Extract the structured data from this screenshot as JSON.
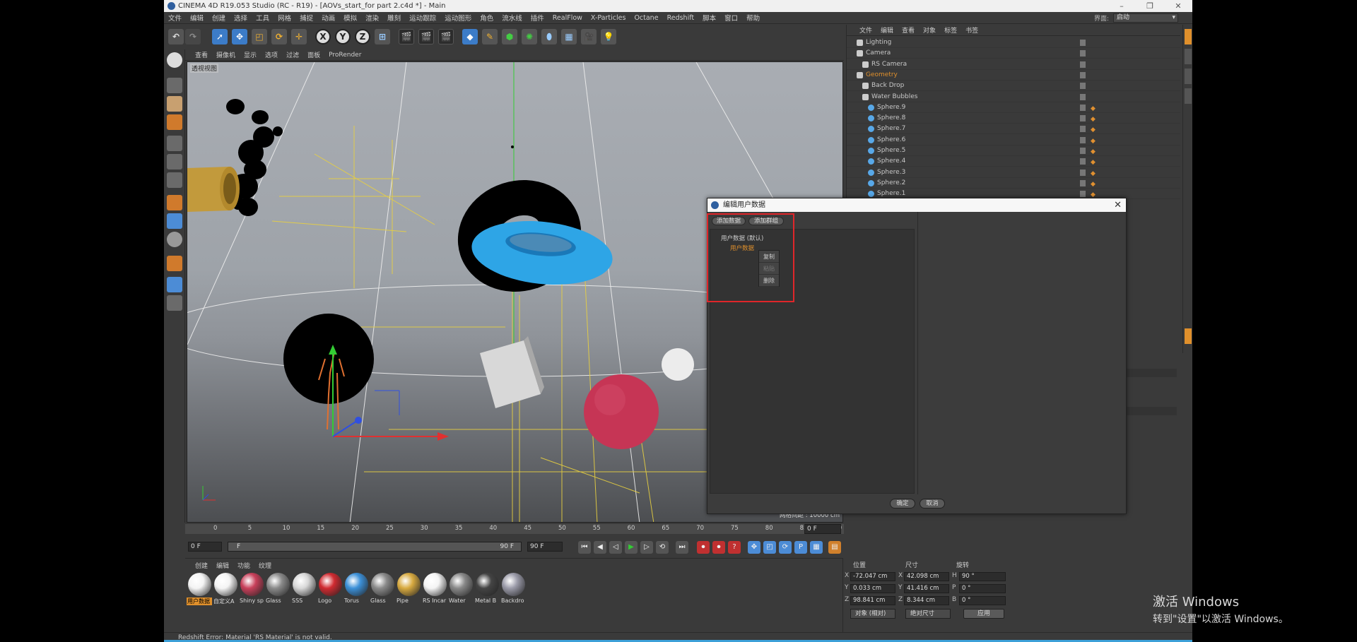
{
  "window": {
    "title": "CINEMA 4D R19.053 Studio (RC - R19) - [AOVs_start_for part 2.c4d *] - Main",
    "controls": [
      "–",
      "❐",
      "✕"
    ]
  },
  "menu": [
    "文件",
    "编辑",
    "创建",
    "选择",
    "工具",
    "网格",
    "捕捉",
    "动画",
    "模拟",
    "渲染",
    "雕刻",
    "运动跟踪",
    "运动图形",
    "角色",
    "流水线",
    "插件",
    "RealFlow",
    "X-Particles",
    "Octane",
    "Redshift",
    "脚本",
    "窗口",
    "帮助"
  ],
  "layout": {
    "label": "界面:",
    "value": "启动"
  },
  "toolbar": {
    "undo": "↶",
    "redo": "↷",
    "axis_x": "X",
    "axis_y": "Y",
    "axis_z": "Z"
  },
  "viewport": {
    "menu": [
      "查看",
      "摄像机",
      "显示",
      "选项",
      "过滤",
      "面板",
      "ProRender"
    ],
    "label": "透视视图",
    "grid_distance": "网格间距 : 10000 cm"
  },
  "timeline": {
    "ticks": [
      "0",
      "5",
      "10",
      "15",
      "20",
      "25",
      "30",
      "35",
      "40",
      "45",
      "50",
      "55",
      "60",
      "65",
      "70",
      "75",
      "80",
      "85",
      "90"
    ],
    "end_frame": "0 F",
    "start_field": "0 F",
    "range_start": "F",
    "range_end": "90 F",
    "max_field": "90 F"
  },
  "materials": {
    "menu": [
      "创建",
      "编辑",
      "功能",
      "纹理"
    ],
    "items": [
      {
        "name": "用户数据",
        "color": "#f4f4f4",
        "selected": true
      },
      {
        "name": "自定义A",
        "color": "#f4f4f4"
      },
      {
        "name": "Shiny sp",
        "color": "#c8405a"
      },
      {
        "name": "Glass",
        "color": "#8a8a8a"
      },
      {
        "name": "SSS",
        "color": "#d8d8d8"
      },
      {
        "name": "Logo",
        "color": "#d02a30"
      },
      {
        "name": "Torus",
        "color": "#3c90d8"
      },
      {
        "name": "Glass",
        "color": "#8a8a8a"
      },
      {
        "name": "Pipe",
        "color": "#d8aa40"
      },
      {
        "name": "RS Incar",
        "color": "#f4f4f4"
      },
      {
        "name": "Water",
        "color": "#888"
      },
      {
        "name": "Metal B",
        "color": "#444"
      },
      {
        "name": "Backdro",
        "color": "#9a9aa8"
      }
    ]
  },
  "coords": {
    "headers": {
      "pos": "位置",
      "size": "尺寸",
      "rot": "旋转"
    },
    "rows": [
      {
        "axis": "X",
        "pos": "-72.047 cm",
        "saxis": "X",
        "size": "42.098 cm",
        "raxis": "H",
        "rot": "90 °"
      },
      {
        "axis": "Y",
        "pos": "0.033 cm",
        "saxis": "Y",
        "size": "41.416 cm",
        "raxis": "P",
        "rot": "0 °"
      },
      {
        "axis": "Z",
        "pos": "98.841 cm",
        "saxis": "Z",
        "size": "8.344 cm",
        "raxis": "B",
        "rot": "0 °"
      }
    ],
    "mode": "对象 (相对)",
    "size_mode": "绝对尺寸",
    "apply": "应用"
  },
  "objects": {
    "menu": [
      "文件",
      "编辑",
      "查看",
      "对象",
      "标签",
      "书签"
    ],
    "rows": [
      {
        "name": "Lighting",
        "indent": 0,
        "type": "null"
      },
      {
        "name": "Camera",
        "indent": 0,
        "type": "null"
      },
      {
        "name": "RS Camera",
        "indent": 1,
        "type": "cam"
      },
      {
        "name": "Geometry",
        "indent": 0,
        "type": "null",
        "orange": true
      },
      {
        "name": "Back Drop",
        "indent": 1,
        "type": "null"
      },
      {
        "name": "Water Bubbles",
        "indent": 1,
        "type": "null"
      },
      {
        "name": "Sphere.9",
        "indent": 2,
        "type": "sph"
      },
      {
        "name": "Sphere.8",
        "indent": 2,
        "type": "sph"
      },
      {
        "name": "Sphere.7",
        "indent": 2,
        "type": "sph"
      },
      {
        "name": "Sphere.6",
        "indent": 2,
        "type": "sph"
      },
      {
        "name": "Sphere.5",
        "indent": 2,
        "type": "sph"
      },
      {
        "name": "Sphere.4",
        "indent": 2,
        "type": "sph"
      },
      {
        "name": "Sphere.3",
        "indent": 2,
        "type": "sph"
      },
      {
        "name": "Sphere.2",
        "indent": 2,
        "type": "sph"
      },
      {
        "name": "Sphere.1",
        "indent": 2,
        "type": "sph"
      }
    ]
  },
  "dialog": {
    "title": "编辑用户数据",
    "add_data": "添加数据",
    "add_group": "添加群组",
    "tree_root": "用户数据 (默认)",
    "tree_child": "用户数据",
    "context_menu": [
      {
        "label": "复制",
        "disabled": false
      },
      {
        "label": "粘贴",
        "disabled": true
      },
      {
        "label": "删除",
        "disabled": false
      }
    ],
    "ok": "确定",
    "cancel": "取消",
    "close": "✕"
  },
  "status": "Redshift Error: Material 'RS Material' is not valid.",
  "watermark": {
    "line1": "激活 Windows",
    "line2": "转到\"设置\"以激活 Windows。"
  },
  "colors": {
    "accent_orange": "#e0902c",
    "highlight_red": "#e0262a",
    "icon_blue": "#3c7cc8"
  }
}
